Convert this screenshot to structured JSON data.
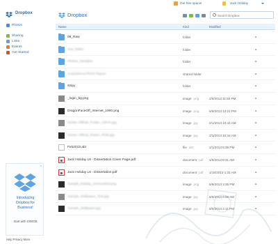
{
  "topbar": {
    "free_space": "Get free space!",
    "user": "Jack Holiday"
  },
  "sidebar": {
    "brand": "Dropbox",
    "items": [
      {
        "label": "Photos",
        "color": "#4c8fd6"
      },
      {
        "label": "Sharing",
        "color": "#8ab83c"
      },
      {
        "label": "Links",
        "color": "#5fa3e0"
      },
      {
        "label": "Events",
        "color": "#e07c3a"
      },
      {
        "label": "Get Started",
        "color": "#d44b4b"
      }
    ],
    "promo": {
      "title_line1": "Introducing",
      "title_line2": "Dropbox for",
      "title_line3": "Business!",
      "subtitle": "Start with 1000GB"
    },
    "footer": "Help  Privacy  More"
  },
  "main": {
    "title": "Dropbox",
    "search_placeholder": "Search Dropbox",
    "columns": {
      "name": "Name",
      "kind": "Kind",
      "modified": "Modified"
    },
    "rows": [
      {
        "icon": "folder-icon",
        "name": "09_Raw",
        "kind": "folder",
        "ext": "",
        "modified": "",
        "blurred": false
      },
      {
        "icon": "folder-icon",
        "name": "Sun_folder",
        "kind": "folder",
        "ext": "",
        "modified": "",
        "blurred": true
      },
      {
        "icon": "folder-icon",
        "name": "Photos_Samples",
        "kind": "folder",
        "ext": "",
        "modified": "",
        "blurred": true
      },
      {
        "icon": "folder-icon",
        "name": "Acquisitions Photo Report",
        "kind": "shared folder",
        "ext": "",
        "modified": "",
        "blurred": true
      },
      {
        "icon": "folder-icon",
        "name": "stripy",
        "kind": "folder",
        "ext": "",
        "modified": "",
        "blurred": false
      },
      {
        "icon": "image-icon",
        "name": "_login_bg.png",
        "kind": "image",
        "ext": "png",
        "modified": "2/6/2013 11:50 PM",
        "blurred": false
      },
      {
        "icon": "image-icon",
        "name": "DragonFaceOff_Internet_1000.png",
        "kind": "image",
        "ext": "png",
        "modified": "5/9/2013 12:21 PM",
        "blurred": false
      },
      {
        "icon": "image-icon",
        "name": "Dexter Official_Poster_CMYK.jpg",
        "kind": "image",
        "ext": "jpg",
        "modified": "2/1/2013 10:44 AM",
        "blurred": true
      },
      {
        "icon": "image-icon",
        "name": "Dexter Official_Poster_RGB.jpg",
        "kind": "image",
        "ext": "jpg",
        "modified": "2/1/2013 10:44 AM",
        "blurred": true
      },
      {
        "icon": "document-icon",
        "name": "Feb2013.abr",
        "kind": "file",
        "ext": "abr",
        "modified": "2/1/2013 6:39 PM",
        "blurred": false
      },
      {
        "icon": "pdf-icon",
        "name": "Jack Holiday L6 - Dissertation Cover Page.pdf",
        "kind": "document",
        "ext": "pdf",
        "modified": "1/9/2013 8:31 AM",
        "blurred": false
      },
      {
        "icon": "pdf-icon",
        "name": "Jack Holiday L6 - Dissertation.pdf",
        "kind": "document",
        "ext": "pdf",
        "modified": "1/15/2013 1:31 AM",
        "blurred": false
      },
      {
        "icon": "image-icon",
        "name": "Sample_holiday_Screenshot.png",
        "kind": "image",
        "ext": "png",
        "modified": "6/9/2013 3:35 PM",
        "blurred": true
      },
      {
        "icon": "image-icon",
        "name": "Sample_Wallpaper_Test.jpg",
        "kind": "image",
        "ext": "jpg",
        "modified": "6/9/2013 9:58 AM",
        "blurred": true
      },
      {
        "icon": "image-icon",
        "name": "Sample_Wallpaper.jpg",
        "kind": "image",
        "ext": "jpg",
        "modified": "6/9/2013 2:11 PM",
        "blurred": true
      }
    ]
  },
  "colors": {
    "accent": "#2a6db5",
    "header_bg": "#e9f2fa",
    "folder": "#5fa3e0"
  }
}
